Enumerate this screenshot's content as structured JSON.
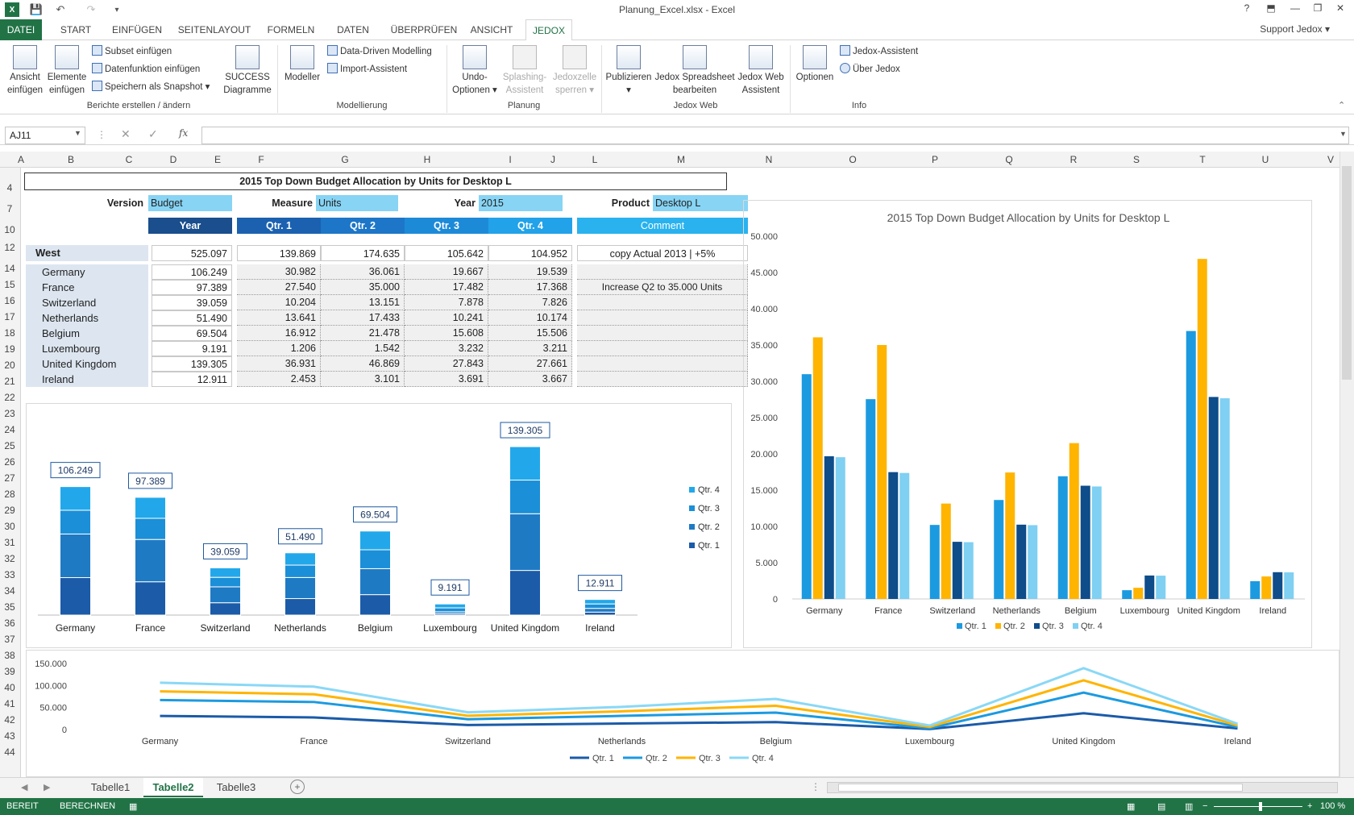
{
  "window": {
    "title": "Planung_Excel.xlsx - Excel",
    "help": "?",
    "min": "—",
    "restore": "❐",
    "close": "✕",
    "user": "Support Jedox ▾"
  },
  "tabs": [
    "DATEI",
    "START",
    "EINFÜGEN",
    "SEITENLAYOUT",
    "FORMELN",
    "DATEN",
    "ÜBERPRÜFEN",
    "ANSICHT",
    "JEDOX"
  ],
  "ribbon": {
    "ansicht": [
      "Ansicht",
      "einfügen"
    ],
    "elemente": [
      "Elemente",
      "einfügen"
    ],
    "subset": "Subset einfügen",
    "datenfunktion": "Datenfunktion einfügen",
    "snapshot": "Speichern als Snapshot",
    "success": [
      "SUCCESS",
      "Diagramme"
    ],
    "group1": "Berichte erstellen / ändern",
    "modeller": "Modeller",
    "ddm": "Data-Driven Modelling",
    "import": "Import-Assistent",
    "group2": "Modellierung",
    "undo": [
      "Undo-",
      "Optionen ▾"
    ],
    "splashing": [
      "Splashing-",
      "Assistent"
    ],
    "jedoxzelle": [
      "Jedoxzelle",
      "sperren ▾"
    ],
    "group3": "Planung",
    "publizieren": [
      "Publizieren",
      "▾"
    ],
    "spreadsheet": [
      "Jedox Spreadsheet",
      "bearbeiten"
    ],
    "webassist": [
      "Jedox Web",
      "Assistent"
    ],
    "group4": "Jedox Web",
    "optionen": "Optionen",
    "jedoxassist": "Jedox-Assistent",
    "ueber": "Über Jedox",
    "group5": "Info"
  },
  "formula": {
    "namebox": "AJ11",
    "value": ""
  },
  "columns": [
    [
      "A",
      26
    ],
    [
      "B",
      88
    ],
    [
      "C",
      160
    ],
    [
      "D",
      215
    ],
    [
      "E",
      270
    ],
    [
      "F",
      324
    ],
    [
      "G",
      428
    ],
    [
      "H",
      530
    ],
    [
      "I",
      633
    ],
    [
      "J",
      686
    ],
    [
      "L",
      738
    ],
    [
      "M",
      845
    ],
    [
      "N",
      954
    ],
    [
      "O",
      1058
    ],
    [
      "P",
      1160
    ],
    [
      "Q",
      1252
    ],
    [
      "R",
      1332
    ],
    [
      "S",
      1410
    ],
    [
      "T",
      1492
    ],
    [
      "U",
      1570
    ],
    [
      "V",
      1651
    ]
  ],
  "rows": [
    [
      "4",
      18
    ],
    [
      "7",
      44
    ],
    [
      "10",
      70
    ],
    [
      "12",
      92
    ],
    [
      "14",
      118
    ],
    [
      "15",
      138
    ],
    [
      "16",
      158
    ],
    [
      "17",
      178
    ],
    [
      "18",
      198
    ],
    [
      "19",
      218
    ],
    [
      "20",
      238
    ],
    [
      "21",
      258
    ],
    [
      "22",
      278
    ],
    [
      "23",
      298
    ],
    [
      "24",
      318
    ],
    [
      "25",
      338
    ],
    [
      "26",
      358
    ],
    [
      "27",
      378
    ],
    [
      "28",
      398
    ],
    [
      "29",
      418
    ],
    [
      "30",
      438
    ],
    [
      "31",
      458
    ],
    [
      "32",
      478
    ],
    [
      "33",
      498
    ],
    [
      "34",
      518
    ],
    [
      "35",
      538
    ],
    [
      "36",
      558
    ],
    [
      "37",
      578
    ],
    [
      "38",
      598
    ],
    [
      "39",
      618
    ],
    [
      "40",
      638
    ],
    [
      "41",
      658
    ],
    [
      "42",
      678
    ],
    [
      "43",
      698
    ],
    [
      "44",
      718
    ]
  ],
  "report": {
    "title": "2015 Top Down Budget Allocation by Units for Desktop L",
    "version_label": "Version",
    "version": "Budget",
    "measure_label": "Measure",
    "measure": "Units",
    "year_label": "Year",
    "year": "2015",
    "product_label": "Product",
    "product": "Desktop L",
    "headers": [
      "Year",
      "Qtr. 1",
      "Qtr. 2",
      "Qtr. 3",
      "Qtr. 4",
      "Comment"
    ],
    "total": {
      "name": "West",
      "values": [
        "525.097",
        "139.869",
        "174.635",
        "105.642",
        "104.952"
      ],
      "comment": "copy Actual 2013 | +5%"
    },
    "rows": [
      {
        "name": "Germany",
        "values": [
          "106.249",
          "30.982",
          "36.061",
          "19.667",
          "19.539"
        ],
        "comment": ""
      },
      {
        "name": "France",
        "values": [
          "97.389",
          "27.540",
          "35.000",
          "17.482",
          "17.368"
        ],
        "comment": "Increase Q2 to 35.000 Units"
      },
      {
        "name": "Switzerland",
        "values": [
          "39.059",
          "10.204",
          "13.151",
          "7.878",
          "7.826"
        ],
        "comment": ""
      },
      {
        "name": "Netherlands",
        "values": [
          "51.490",
          "13.641",
          "17.433",
          "10.241",
          "10.174"
        ],
        "comment": ""
      },
      {
        "name": "Belgium",
        "values": [
          "69.504",
          "16.912",
          "21.478",
          "15.608",
          "15.506"
        ],
        "comment": ""
      },
      {
        "name": "Luxembourg",
        "values": [
          "9.191",
          "1.206",
          "1.542",
          "3.232",
          "3.211"
        ],
        "comment": ""
      },
      {
        "name": "United Kingdom",
        "values": [
          "139.305",
          "36.931",
          "46.869",
          "27.843",
          "27.661"
        ],
        "comment": ""
      },
      {
        "name": "Ireland",
        "values": [
          "12.911",
          "2.453",
          "3.101",
          "3.691",
          "3.667"
        ],
        "comment": ""
      }
    ]
  },
  "chart_data": [
    {
      "type": "bar",
      "stacked": true,
      "categories": [
        "Germany",
        "France",
        "Switzerland",
        "Netherlands",
        "Belgium",
        "Luxembourg",
        "United Kingdom",
        "Ireland"
      ],
      "series": [
        {
          "name": "Qtr. 1",
          "values": [
            30982,
            27540,
            10204,
            13641,
            16912,
            1206,
            36931,
            2453
          ]
        },
        {
          "name": "Qtr. 2",
          "values": [
            36061,
            35000,
            13151,
            17433,
            21478,
            1542,
            46869,
            3101
          ]
        },
        {
          "name": "Qtr. 3",
          "values": [
            19667,
            17482,
            7878,
            10241,
            15608,
            3232,
            27843,
            3691
          ]
        },
        {
          "name": "Qtr. 4",
          "values": [
            19539,
            17368,
            7826,
            10174,
            15506,
            3211,
            27661,
            3667
          ]
        }
      ],
      "totals": [
        "106.249",
        "97.389",
        "39.059",
        "51.490",
        "69.504",
        "9.191",
        "139.305",
        "12.911"
      ],
      "legend": "right",
      "colors": [
        "#1b5ba8",
        "#1f7ac4",
        "#1b8fd8",
        "#22a8ea"
      ]
    },
    {
      "type": "bar",
      "title": "2015 Top Down Budget Allocation by Units for Desktop L",
      "categories": [
        "Germany",
        "France",
        "Switzerland",
        "Netherlands",
        "Belgium",
        "Luxembourg",
        "United Kingdom",
        "Ireland"
      ],
      "series": [
        {
          "name": "Qtr. 1",
          "values": [
            30982,
            27540,
            10204,
            13641,
            16912,
            1206,
            36931,
            2453
          ]
        },
        {
          "name": "Qtr. 2",
          "values": [
            36061,
            35000,
            13151,
            17433,
            21478,
            1542,
            46869,
            3101
          ]
        },
        {
          "name": "Qtr. 3",
          "values": [
            19667,
            17482,
            7878,
            10241,
            15608,
            3232,
            27843,
            3691
          ]
        },
        {
          "name": "Qtr. 4",
          "values": [
            19539,
            17368,
            7826,
            10174,
            15506,
            3211,
            27661,
            3667
          ]
        }
      ],
      "yticks": [
        "50.000",
        "45.000",
        "40.000",
        "35.000",
        "30.000",
        "25.000",
        "20.000",
        "15.000",
        "10.000",
        "5.000",
        "0"
      ],
      "ylim": [
        0,
        50000
      ],
      "legend": "bottom",
      "colors": [
        "#1c9ae0",
        "#ffb400",
        "#0e4c8a",
        "#7fd0f2"
      ]
    },
    {
      "type": "line",
      "stacked": true,
      "categories": [
        "Germany",
        "France",
        "Switzerland",
        "Netherlands",
        "Belgium",
        "Luxembourg",
        "United Kingdom",
        "Ireland"
      ],
      "series": [
        {
          "name": "Qtr. 1",
          "values": [
            30982,
            27540,
            10204,
            13641,
            16912,
            1206,
            36931,
            2453
          ]
        },
        {
          "name": "Qtr. 2",
          "values": [
            36061,
            35000,
            13151,
            17433,
            21478,
            1542,
            46869,
            3101
          ]
        },
        {
          "name": "Qtr. 3",
          "values": [
            19667,
            17482,
            7878,
            10241,
            15608,
            3232,
            27843,
            3691
          ]
        },
        {
          "name": "Qtr. 4",
          "values": [
            19539,
            17368,
            7826,
            10174,
            15506,
            3211,
            27661,
            3667
          ]
        }
      ],
      "yticks": [
        "150.000",
        "100.000",
        "50.000",
        "0"
      ],
      "ylim": [
        0,
        150000
      ],
      "legend": "bottom",
      "colors": [
        "#1b5ba8",
        "#1c9ae0",
        "#ffb400",
        "#8ad8f6"
      ]
    }
  ],
  "sheets": [
    "Tabelle1",
    "Tabelle2",
    "Tabelle3"
  ],
  "status": {
    "ready": "BEREIT",
    "calc": "BERECHNEN",
    "zoom": "100 %"
  }
}
